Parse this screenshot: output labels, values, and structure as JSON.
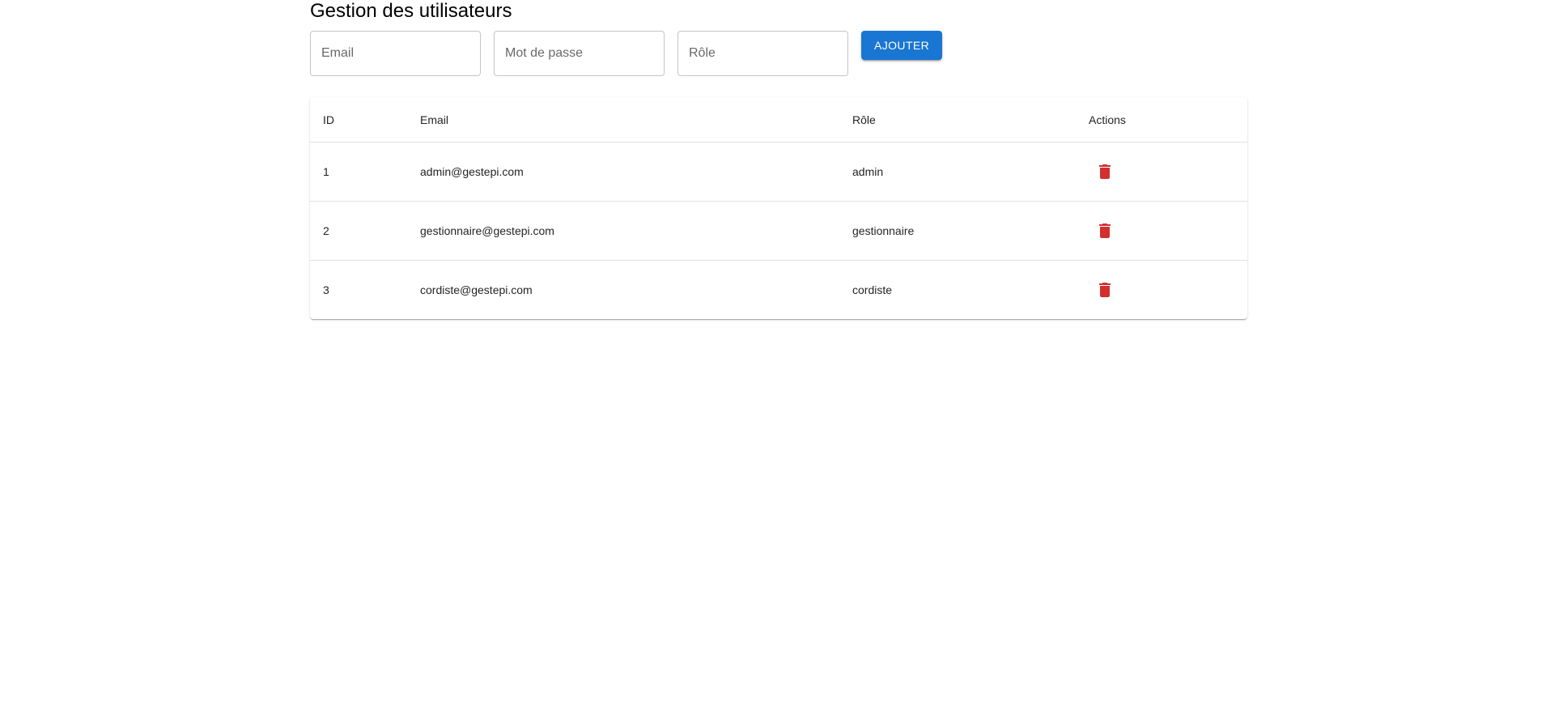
{
  "page": {
    "title": "Gestion des utilisateurs"
  },
  "form": {
    "email_placeholder": "Email",
    "password_placeholder": "Mot de passe",
    "role_placeholder": "Rôle",
    "add_label": "AJOUTER"
  },
  "table": {
    "headers": {
      "id": "ID",
      "email": "Email",
      "role": "Rôle",
      "actions": "Actions"
    },
    "rows": [
      {
        "id": "1",
        "email": "admin@gestepi.com",
        "role": "admin"
      },
      {
        "id": "2",
        "email": "gestionnaire@gestepi.com",
        "role": "gestionnaire"
      },
      {
        "id": "3",
        "email": "cordiste@gestepi.com",
        "role": "cordiste"
      }
    ]
  },
  "colors": {
    "primary": "#1976d2",
    "danger": "#d32f2f"
  },
  "icons": {
    "delete": "delete-icon"
  }
}
